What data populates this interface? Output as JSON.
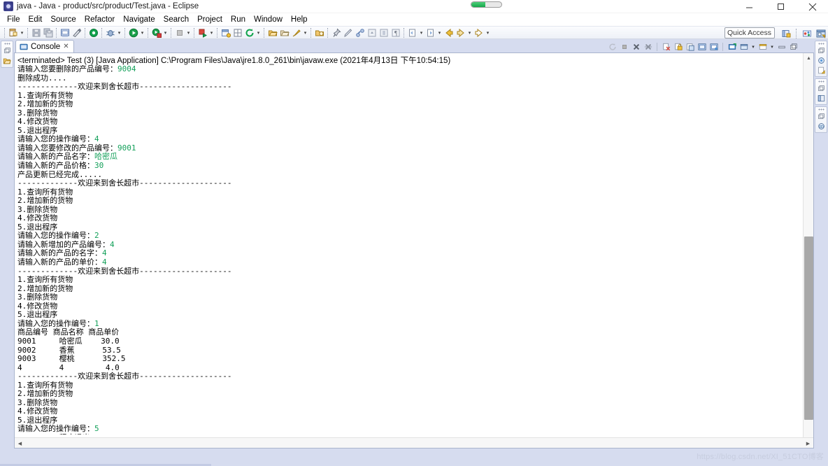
{
  "window": {
    "title": "java - Java - product/src/product/Test.java - Eclipse",
    "app_icon": "eclipse-icon",
    "progress_icon": "progress-bar",
    "minimize_label": "Minimize",
    "maximize_label": "Maximize",
    "close_label": "Close"
  },
  "menubar": {
    "items": [
      {
        "label": "File",
        "mnemonic": "F"
      },
      {
        "label": "Edit",
        "mnemonic": "E"
      },
      {
        "label": "Source",
        "mnemonic": "S"
      },
      {
        "label": "Refactor",
        "mnemonic": "t"
      },
      {
        "label": "Navigate",
        "mnemonic": "N"
      },
      {
        "label": "Search",
        "mnemonic": "S"
      },
      {
        "label": "Project",
        "mnemonic": "P"
      },
      {
        "label": "Run",
        "mnemonic": "R"
      },
      {
        "label": "Window",
        "mnemonic": "W"
      },
      {
        "label": "Help",
        "mnemonic": "H"
      }
    ]
  },
  "toolbar": {
    "quick_access_placeholder": "Quick Access",
    "buttons": [
      {
        "name": "new-wizard-icon"
      },
      {
        "name": "save-icon"
      },
      {
        "name": "save-all-icon"
      },
      {
        "name": "print-icon"
      },
      {
        "name": "toggle-mark-occurrences-icon"
      },
      {
        "name": "new-java-package-icon"
      },
      {
        "name": "debug-icon"
      },
      {
        "name": "run-icon"
      },
      {
        "name": "run-coverage-icon"
      },
      {
        "name": "terminate-icon"
      },
      {
        "name": "external-tools-icon"
      },
      {
        "name": "new-java-project-icon"
      },
      {
        "name": "new-java-class-icon"
      },
      {
        "name": "refresh-icon"
      },
      {
        "name": "open-type-icon"
      },
      {
        "name": "open-task-icon"
      },
      {
        "name": "search-icon"
      },
      {
        "name": "open-resource-icon"
      },
      {
        "name": "pin-editor-icon"
      },
      {
        "name": "pencil-icon"
      },
      {
        "name": "link-icon"
      },
      {
        "name": "previous-annotation-icon"
      },
      {
        "name": "next-annotation-icon"
      },
      {
        "name": "last-edit-location-icon"
      },
      {
        "name": "back-icon"
      },
      {
        "name": "forward-icon"
      }
    ],
    "perspective_buttons": [
      {
        "name": "open-perspective-icon"
      },
      {
        "name": "java-ee-perspective-icon"
      },
      {
        "name": "java-perspective-icon"
      }
    ]
  },
  "left_rail": {
    "items": [
      {
        "name": "restore-icon"
      },
      {
        "name": "package-explorer-icon"
      }
    ]
  },
  "right_rail": {
    "stacks": [
      {
        "items": [
          {
            "name": "restore-icon"
          },
          {
            "name": "outline-icon"
          },
          {
            "name": "task-list-icon"
          }
        ]
      },
      {
        "items": [
          {
            "name": "restore-icon"
          },
          {
            "name": "servers-view-icon"
          }
        ]
      },
      {
        "items": [
          {
            "name": "restore-icon"
          },
          {
            "name": "snippets-icon"
          }
        ]
      }
    ]
  },
  "console": {
    "tab_label": "Console",
    "tab_icon": "console-icon",
    "tab_close_icon": "close-icon",
    "description": "<terminated> Test (3) [Java Application] C:\\Program Files\\Java\\jre1.8.0_261\\bin\\javaw.exe (2021年4月13日 下午10:54:15)",
    "toolbar_buttons": [
      {
        "name": "terminate-and-relaunch-icon"
      },
      {
        "name": "terminate-icon"
      },
      {
        "name": "remove-launch-icon"
      },
      {
        "name": "remove-all-terminated-icon"
      },
      {
        "name": "clear-console-icon"
      },
      {
        "name": "scroll-lock-icon"
      },
      {
        "name": "show-console-on-output-icon"
      },
      {
        "name": "pin-console-icon"
      },
      {
        "name": "display-selected-console-icon"
      },
      {
        "name": "open-console-icon"
      },
      {
        "name": "new-console-view-icon"
      },
      {
        "name": "minimize-icon"
      },
      {
        "name": "maximize-icon"
      }
    ],
    "output_lines": [
      [
        {
          "t": "请输入您要删除的产品编号：",
          "c": "k"
        },
        {
          "t": "9004",
          "c": "g"
        }
      ],
      [
        {
          "t": "删除成功....",
          "c": "k"
        }
      ],
      [
        {
          "t": "-------------欢迎来到舍长超市--------------------",
          "c": "k"
        }
      ],
      [
        {
          "t": "1.查询所有货物",
          "c": "k"
        }
      ],
      [
        {
          "t": "2.增加新的货物",
          "c": "k"
        }
      ],
      [
        {
          "t": "3.删除货物",
          "c": "k"
        }
      ],
      [
        {
          "t": "4.修改货物",
          "c": "k"
        }
      ],
      [
        {
          "t": "5.退出程序",
          "c": "k"
        }
      ],
      [
        {
          "t": "请输入您的操作编号：",
          "c": "k"
        },
        {
          "t": "4",
          "c": "g"
        }
      ],
      [
        {
          "t": "请输入您要修改的产品编号：",
          "c": "k"
        },
        {
          "t": "9001",
          "c": "g"
        }
      ],
      [
        {
          "t": "请输入新的产品名字：",
          "c": "k"
        },
        {
          "t": "哈密瓜",
          "c": "g"
        }
      ],
      [
        {
          "t": "请输入新的产品价格：",
          "c": "k"
        },
        {
          "t": "30",
          "c": "g"
        }
      ],
      [
        {
          "t": "产品更新已经完成.....",
          "c": "k"
        }
      ],
      [
        {
          "t": "-------------欢迎来到舍长超市--------------------",
          "c": "k"
        }
      ],
      [
        {
          "t": "1.查询所有货物",
          "c": "k"
        }
      ],
      [
        {
          "t": "2.增加新的货物",
          "c": "k"
        }
      ],
      [
        {
          "t": "3.删除货物",
          "c": "k"
        }
      ],
      [
        {
          "t": "4.修改货物",
          "c": "k"
        }
      ],
      [
        {
          "t": "5.退出程序",
          "c": "k"
        }
      ],
      [
        {
          "t": "请输入您的操作编号：",
          "c": "k"
        },
        {
          "t": "2",
          "c": "g"
        }
      ],
      [
        {
          "t": "请输入新增加的产品编号：",
          "c": "k"
        },
        {
          "t": "4",
          "c": "g"
        }
      ],
      [
        {
          "t": "请输入新的产品的名字：",
          "c": "k"
        },
        {
          "t": "4",
          "c": "g"
        }
      ],
      [
        {
          "t": "请输入新的产品的单价：",
          "c": "k"
        },
        {
          "t": "4",
          "c": "g"
        }
      ],
      [
        {
          "t": "-------------欢迎来到舍长超市--------------------",
          "c": "k"
        }
      ],
      [
        {
          "t": "1.查询所有货物",
          "c": "k"
        }
      ],
      [
        {
          "t": "2.增加新的货物",
          "c": "k"
        }
      ],
      [
        {
          "t": "3.删除货物",
          "c": "k"
        }
      ],
      [
        {
          "t": "4.修改货物",
          "c": "k"
        }
      ],
      [
        {
          "t": "5.退出程序",
          "c": "k"
        }
      ],
      [
        {
          "t": "请输入您的操作编号：",
          "c": "k"
        },
        {
          "t": "1",
          "c": "g"
        }
      ],
      [
        {
          "t": "商品编号 商品名称 商品单价",
          "c": "k"
        }
      ],
      [
        {
          "t": "9001     哈密瓜    30.0",
          "c": "k"
        }
      ],
      [
        {
          "t": "9002     香蕉      53.5",
          "c": "k"
        }
      ],
      [
        {
          "t": "9003     樱桃      352.5",
          "c": "k"
        }
      ],
      [
        {
          "t": "4        4         4.0",
          "c": "k"
        }
      ],
      [
        {
          "t": "-------------欢迎来到舍长超市--------------------",
          "c": "k"
        }
      ],
      [
        {
          "t": "1.查询所有货物",
          "c": "k"
        }
      ],
      [
        {
          "t": "2.增加新的货物",
          "c": "k"
        }
      ],
      [
        {
          "t": "3.删除货物",
          "c": "k"
        }
      ],
      [
        {
          "t": "4.修改货物",
          "c": "k"
        }
      ],
      [
        {
          "t": "5.退出程序",
          "c": "k"
        }
      ],
      [
        {
          "t": "请输入您的操作编号：",
          "c": "k"
        },
        {
          "t": "5",
          "c": "g"
        }
      ],
      [
        {
          "t": "---------程序退出----------",
          "c": "k"
        }
      ]
    ],
    "input_echo_color": "#14a05a",
    "text_color": "#000000"
  },
  "statusbar": {
    "watermark": "https://blog.csdn.net/XI_51CTO博客"
  }
}
